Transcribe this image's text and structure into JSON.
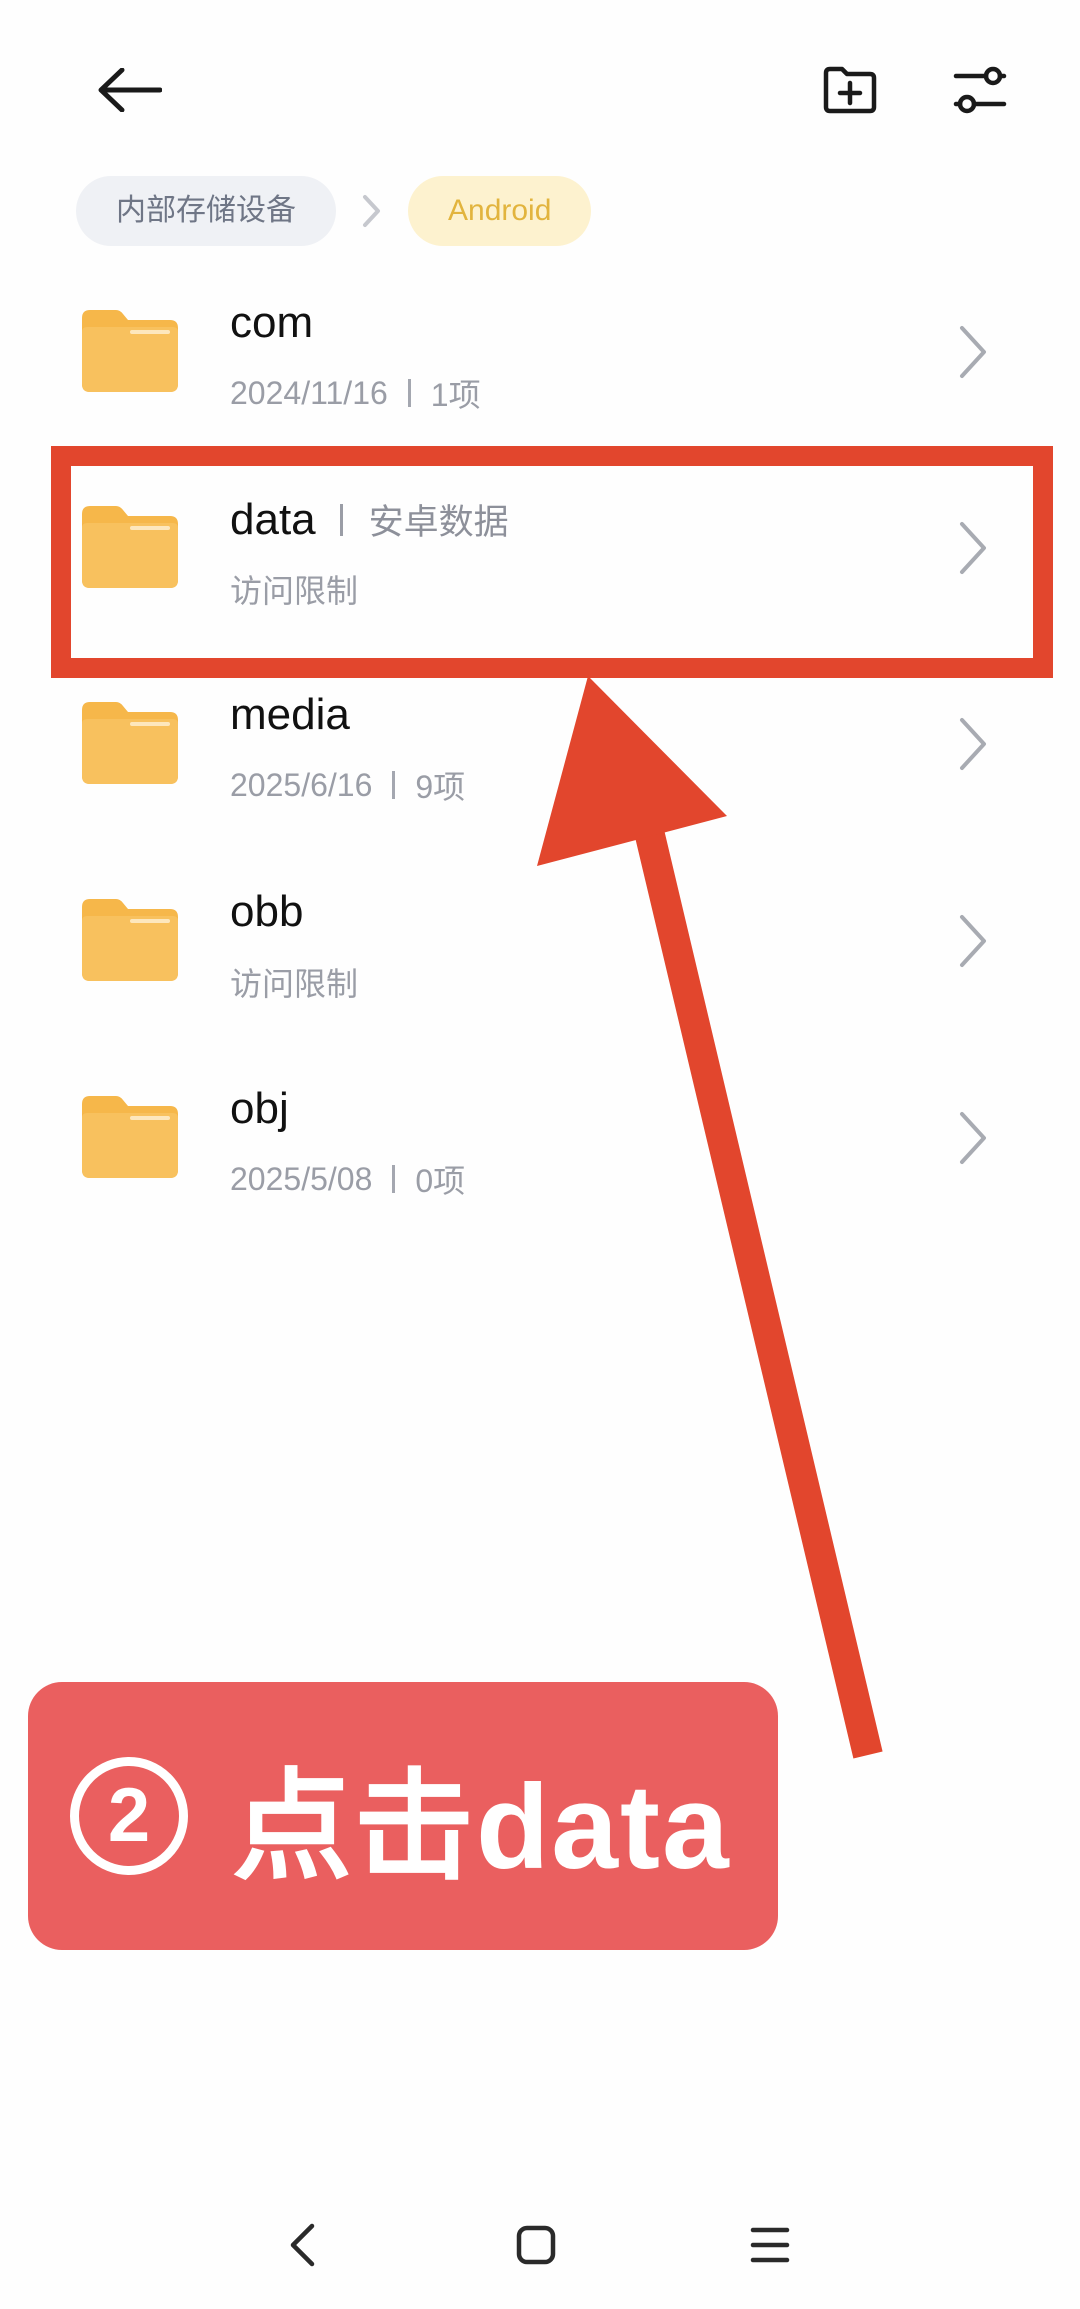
{
  "icons": {
    "back": "arrow-left-icon",
    "new_folder": "folder-plus-icon",
    "filter": "sliders-icon",
    "breadcrumb_sep": "chevron-right-icon",
    "folder": "folder-icon",
    "row_chevron": "chevron-right-icon",
    "nav_back": "chevron-left-icon",
    "nav_home": "square-icon",
    "nav_menu": "menu-icon"
  },
  "colors": {
    "folder": "#f6b74a",
    "folder_tab": "#f3ad3d",
    "accent": "#e2b43d",
    "annotation_red": "#e2462d",
    "callout_bg": "#ea5f5f"
  },
  "breadcrumb": {
    "root": "内部存储设备",
    "current": "Android"
  },
  "files": [
    {
      "name": "com",
      "tag": "",
      "date": "2024/11/16",
      "count": "1项",
      "status": ""
    },
    {
      "name": "data",
      "tag": "安卓数据",
      "date": "",
      "count": "",
      "status": "访问限制"
    },
    {
      "name": "media",
      "tag": "",
      "date": "2025/6/16",
      "count": "9项",
      "status": ""
    },
    {
      "name": "obb",
      "tag": "",
      "date": "",
      "count": "",
      "status": "访问限制"
    },
    {
      "name": "obj",
      "tag": "",
      "date": "2025/5/08",
      "count": "0项",
      "status": ""
    }
  ],
  "annotation": {
    "step_number": "2",
    "instruction": "点击data"
  }
}
